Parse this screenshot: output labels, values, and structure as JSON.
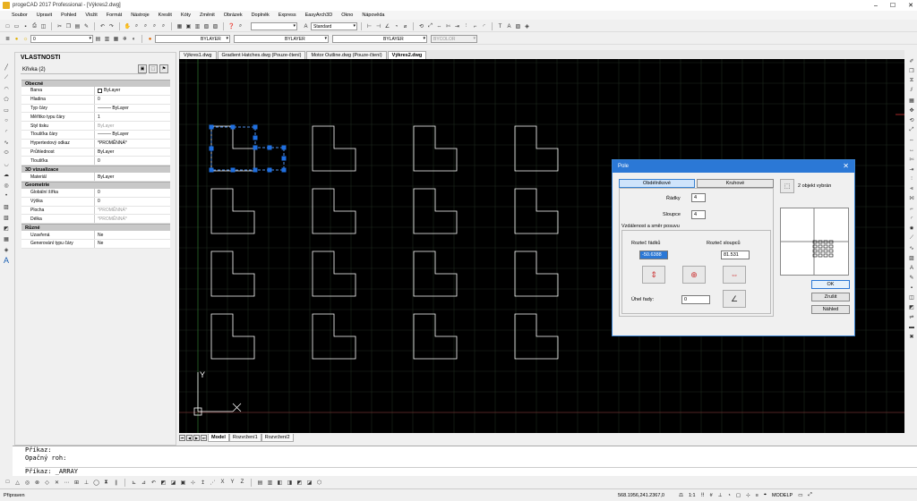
{
  "window": {
    "title": "progeCAD 2017 Professional - [Výkres2.dwg]",
    "controls": [
      "–",
      "☐",
      "✕"
    ]
  },
  "menu": [
    "Soubor",
    "Upravit",
    "Pohled",
    "Vložit",
    "Formát",
    "Nástroje",
    "Kreslit",
    "Kóty",
    "Změnit",
    "Obrázek",
    "Doplněk",
    "Express",
    "EasyArch3D",
    "Okno",
    "Nápověda"
  ],
  "toolbar2": {
    "style_combo": "Standard"
  },
  "toolbar3": {
    "layer_combo": "0",
    "color_combo": "BYLAYER",
    "linetype_combo": "BYLAYER",
    "lineweight_combo": "BYLAYER",
    "plotstyle_combo": "BYCOLOR"
  },
  "properties": {
    "title": "VLASTNOSTI",
    "selection": "Křivka (2)",
    "sections": [
      {
        "name": "Obecné",
        "rows": [
          {
            "k": "Barva",
            "v": "ByLayer",
            "swatch": true
          },
          {
            "k": "Hladina",
            "v": "0"
          },
          {
            "k": "Typ čáry",
            "v": "——— ByLayer"
          },
          {
            "k": "Měřítko typu čáry",
            "v": "1"
          },
          {
            "k": "Styl tisku",
            "v": "ByLayer",
            "gray": true
          },
          {
            "k": "Tloušťka čáry",
            "v": "——— ByLayer"
          },
          {
            "k": "Hypertextový odkaz",
            "v": "*PROMĚNNÁ*"
          },
          {
            "k": "Průhlednost",
            "v": "ByLayer"
          },
          {
            "k": "Tloušťka",
            "v": "0"
          }
        ]
      },
      {
        "name": "3D vizualizace",
        "rows": [
          {
            "k": "Materiál",
            "v": "ByLayer"
          }
        ]
      },
      {
        "name": "Geometrie",
        "rows": [
          {
            "k": "Globální šířka",
            "v": "0"
          },
          {
            "k": "Výška",
            "v": "0"
          },
          {
            "k": "Plocha",
            "v": "*PROMĚNNÁ*",
            "gray": true
          },
          {
            "k": "Délka",
            "v": "*PROMĚNNÁ*",
            "gray": true
          }
        ]
      },
      {
        "name": "Různé",
        "rows": [
          {
            "k": "Uzavřená",
            "v": "Ne"
          },
          {
            "k": "Generování typu čáry",
            "v": "Ne"
          }
        ]
      }
    ]
  },
  "doc_tabs": [
    {
      "label": "Výkres1.dwg",
      "active": false
    },
    {
      "label": "Gradient Hatches.dwg (Pouze-čtení)",
      "active": false
    },
    {
      "label": "Motor Outline.dwg (Pouze-čtení)",
      "active": false
    },
    {
      "label": "Výkres2.dwg",
      "active": true
    }
  ],
  "layout_tabs": [
    {
      "label": "Model",
      "active": true
    },
    {
      "label": "Rozvržení1",
      "active": false
    },
    {
      "label": "Rozvržení2",
      "active": false
    }
  ],
  "canvas": {
    "ucs_label": "Y"
  },
  "dialog": {
    "title": "Pole",
    "tab_rect": "Obdélníkové",
    "tab_polar": "Kruhové",
    "rows_label": "Řádky",
    "rows_value": "4",
    "cols_label": "Sloupce",
    "cols_value": "4",
    "offset_group": "Vzdálenost a směr posuvu",
    "row_offset_label": "Rozteč řádků",
    "row_offset_value": "-50.6388",
    "col_offset_label": "Rozteč sloupců",
    "col_offset_value": "81.531",
    "angle_label": "Úhel řady:",
    "angle_value": "0",
    "selected_text": "2 objekt vybrán",
    "ok": "OK",
    "cancel": "Zrušit",
    "preview": "Náhled"
  },
  "command": {
    "line1": "Příkaz:",
    "line2": "Opačný roh:",
    "line3": "Příkaz: _ARRAY"
  },
  "status": {
    "left": "Připraven",
    "coords": "568.1956,241.2367,0",
    "scale": "1:1",
    "modelp": "MODELP"
  }
}
